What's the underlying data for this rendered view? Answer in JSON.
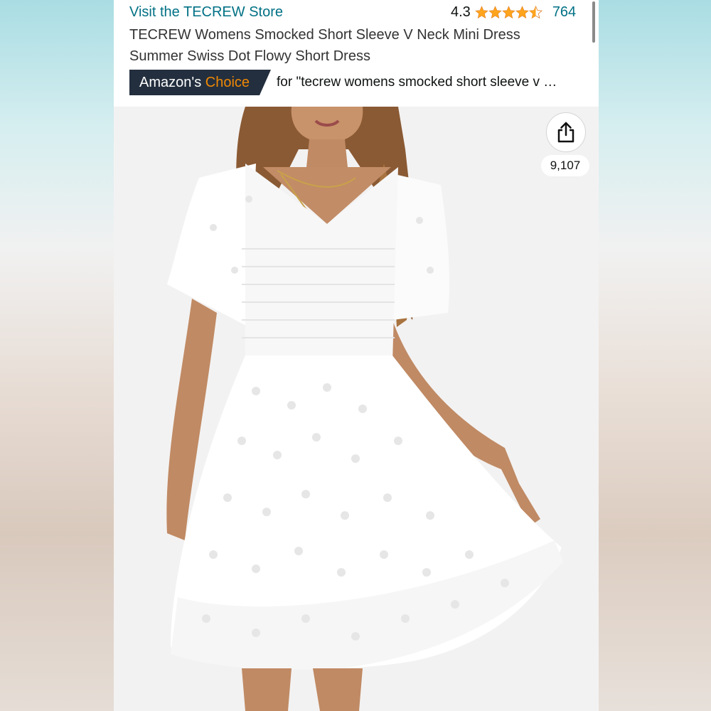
{
  "header": {
    "store_link": "Visit the TECREW Store",
    "rating_value": "4.3",
    "rating_stars": 4.3,
    "review_count": "764",
    "title": "TECREW Womens Smocked Short Sleeve V Neck Mini Dress Summer Swiss Dot Flowy Short Dress",
    "badge": {
      "amazons": "Amazon's",
      "choice": "Choice",
      "for_text": "for \"tecrew womens smocked short sleeve v …"
    }
  },
  "image_panel": {
    "share_icon": "share-icon",
    "share_count": "9,107"
  },
  "colors": {
    "link": "#007185",
    "badge_bg": "#232f3e",
    "choice_orange": "#f08804",
    "star": "#ffa41c"
  }
}
